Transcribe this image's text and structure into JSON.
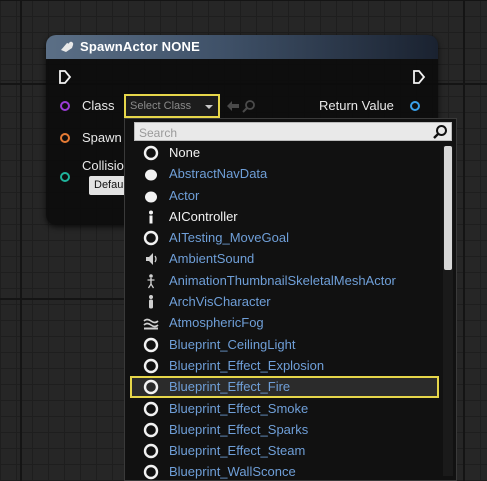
{
  "node": {
    "title": "SpawnActor NONE",
    "pins": {
      "class_label": "Class",
      "class_value": "Select Class",
      "return_label": "Return Value",
      "spawn_label": "Spawn",
      "collision_label": "Collisio",
      "default_button": "Defau"
    },
    "colors": {
      "class_pin": "#9b3bd6",
      "spawn_pin": "#e57b35",
      "collision_pin": "#1fb39b",
      "return_pin": "#3aa0ea"
    }
  },
  "dropdown": {
    "search_placeholder": "Search",
    "items": [
      {
        "label": "None",
        "icon": "circle-ring-icon",
        "white": true
      },
      {
        "label": "AbstractNavData",
        "icon": "sphere-icon",
        "white": false
      },
      {
        "label": "Actor",
        "icon": "sphere-icon",
        "white": false
      },
      {
        "label": "AIController",
        "icon": "pawn-figure-icon",
        "white": true
      },
      {
        "label": "AITesting_MoveGoal",
        "icon": "circle-ring-icon",
        "white": false
      },
      {
        "label": "AmbientSound",
        "icon": "speaker-icon",
        "white": false
      },
      {
        "label": "AnimationThumbnailSkeletalMeshActor",
        "icon": "skeleton-figure-icon",
        "white": false
      },
      {
        "label": "ArchVisCharacter",
        "icon": "character-figure-icon",
        "white": false
      },
      {
        "label": "AtmosphericFog",
        "icon": "fog-icon",
        "white": false
      },
      {
        "label": "Blueprint_CeilingLight",
        "icon": "circle-ring-icon",
        "white": false
      },
      {
        "label": "Blueprint_Effect_Explosion",
        "icon": "circle-ring-icon",
        "white": false
      },
      {
        "label": "Blueprint_Effect_Fire",
        "icon": "circle-ring-icon",
        "white": false,
        "selected": true
      },
      {
        "label": "Blueprint_Effect_Smoke",
        "icon": "circle-ring-icon",
        "white": false
      },
      {
        "label": "Blueprint_Effect_Sparks",
        "icon": "circle-ring-icon",
        "white": false
      },
      {
        "label": "Blueprint_Effect_Steam",
        "icon": "circle-ring-icon",
        "white": false
      },
      {
        "label": "Blueprint_WallSconce",
        "icon": "circle-ring-icon",
        "white": false
      }
    ]
  }
}
